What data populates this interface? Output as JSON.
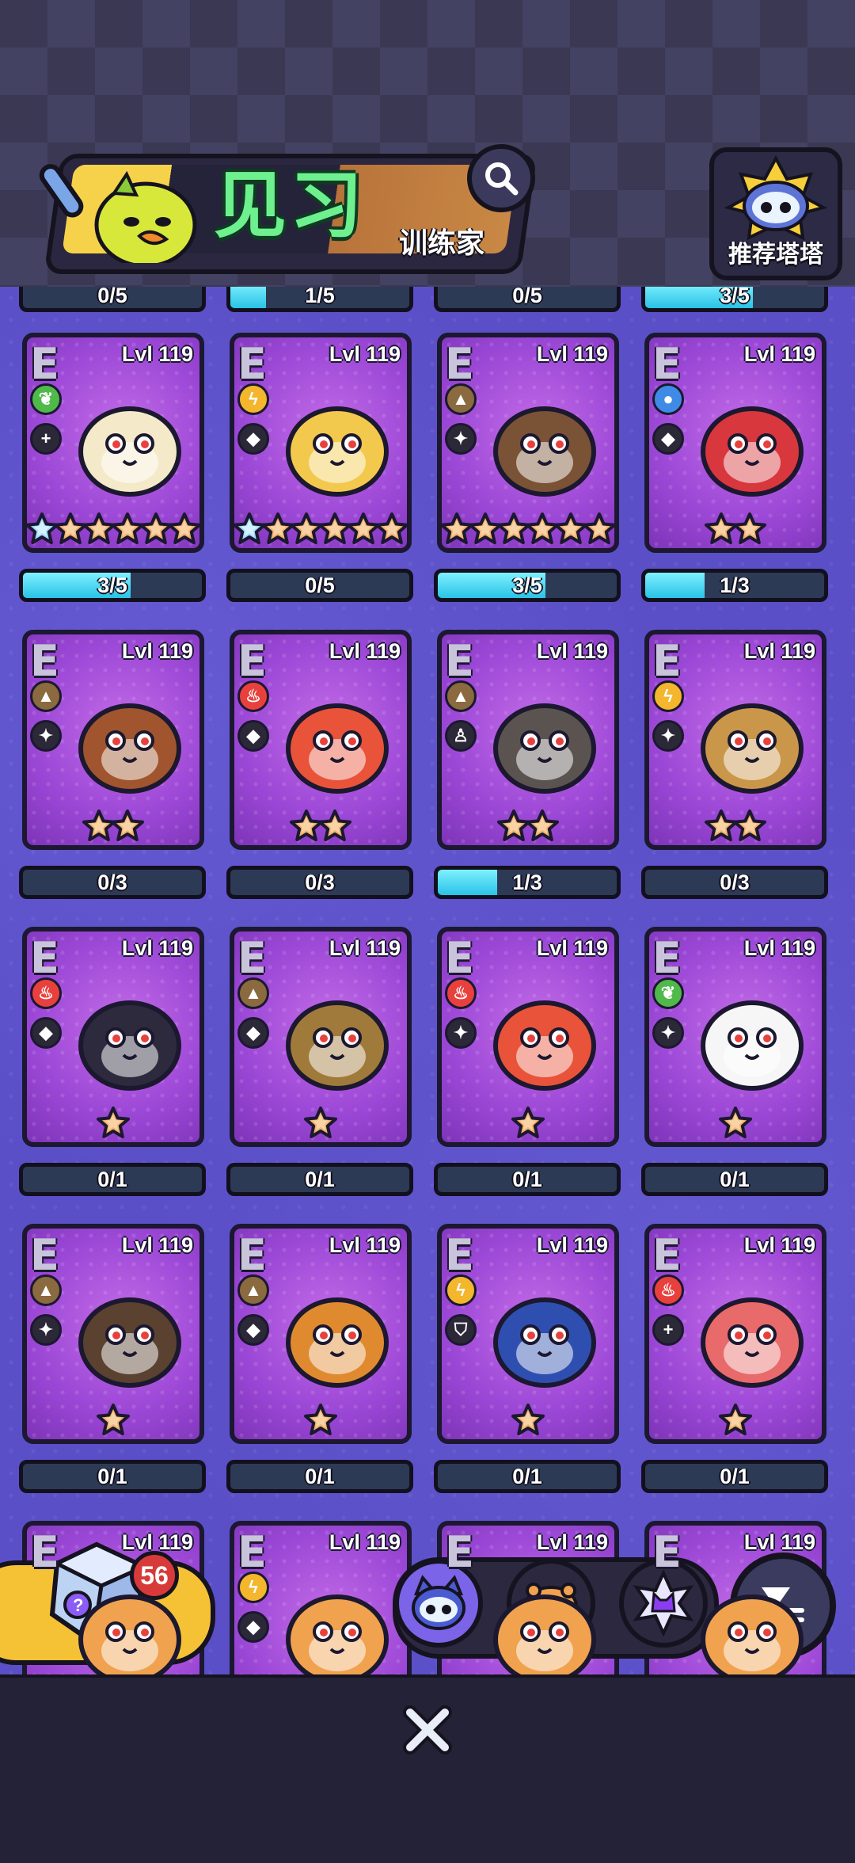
{
  "header": {
    "title": "见习",
    "subtitle": "训练家",
    "search_icon": "search-icon",
    "recommend_label": "推荐塔塔"
  },
  "top_partial_progress": [
    {
      "text": "0/5",
      "fraction": 0
    },
    {
      "text": "1/5",
      "fraction": 0.2
    },
    {
      "text": "0/5",
      "fraction": 0
    },
    {
      "text": "3/5",
      "fraction": 0.6
    }
  ],
  "cards": [
    {
      "grade": "E",
      "level": "Lvl 119",
      "element": "leaf",
      "role": "heal",
      "stars": 6,
      "blue_stars": 1,
      "progress": "3/5",
      "fraction": 0.6,
      "creature": "leaf-nest-creature"
    },
    {
      "grade": "E",
      "level": "Lvl 119",
      "element": "lightning",
      "role": "ranged",
      "stars": 6,
      "blue_stars": 1,
      "progress": "0/5",
      "fraction": 0,
      "creature": "yellow-cat-creature"
    },
    {
      "grade": "E",
      "level": "Lvl 119",
      "element": "earth",
      "role": "melee",
      "stars": 6,
      "blue_stars": 0,
      "progress": "3/5",
      "fraction": 0.6,
      "creature": "boar-creature"
    },
    {
      "grade": "E",
      "level": "Lvl 119",
      "element": "water",
      "role": "ranged",
      "stars": 2,
      "blue_stars": 0,
      "progress": "1/3",
      "fraction": 0.33,
      "creature": "crab-creature"
    },
    {
      "grade": "E",
      "level": "Lvl 119",
      "element": "earth",
      "role": "melee",
      "stars": 2,
      "blue_stars": 0,
      "progress": "0/3",
      "fraction": 0,
      "creature": "bird-creature"
    },
    {
      "grade": "E",
      "level": "Lvl 119",
      "element": "fire",
      "role": "ranged",
      "stars": 2,
      "blue_stars": 0,
      "progress": "0/3",
      "fraction": 0,
      "creature": "fire-bird-creature"
    },
    {
      "grade": "E",
      "level": "Lvl 119",
      "element": "earth",
      "role": "potion",
      "stars": 2,
      "blue_stars": 0,
      "progress": "1/3",
      "fraction": 0.33,
      "creature": "raccoon-creature"
    },
    {
      "grade": "E",
      "level": "Lvl 119",
      "element": "lightning",
      "role": "melee",
      "stars": 2,
      "blue_stars": 0,
      "progress": "0/3",
      "fraction": 0,
      "creature": "monkey-cage-creature"
    },
    {
      "grade": "E",
      "level": "Lvl 119",
      "element": "fire",
      "role": "ranged",
      "stars": 1,
      "blue_stars": 0,
      "progress": "0/1",
      "fraction": 0,
      "creature": "shiba-creature"
    },
    {
      "grade": "E",
      "level": "Lvl 119",
      "element": "earth",
      "role": "ranged",
      "stars": 1,
      "blue_stars": 0,
      "progress": "0/1",
      "fraction": 0,
      "creature": "turtle-creature"
    },
    {
      "grade": "E",
      "level": "Lvl 119",
      "element": "fire",
      "role": "melee",
      "stars": 1,
      "blue_stars": 0,
      "progress": "0/1",
      "fraction": 0,
      "creature": "red-fox-creature"
    },
    {
      "grade": "E",
      "level": "Lvl 119",
      "element": "leaf",
      "role": "melee",
      "stars": 1,
      "blue_stars": 0,
      "progress": "0/1",
      "fraction": 0,
      "creature": "panda-creature"
    },
    {
      "grade": "E",
      "level": "Lvl 119",
      "element": "earth",
      "role": "melee",
      "stars": 1,
      "blue_stars": 0,
      "progress": "0/1",
      "fraction": 0,
      "creature": "mole-creature"
    },
    {
      "grade": "E",
      "level": "Lvl 119",
      "element": "earth",
      "role": "ranged",
      "stars": 1,
      "blue_stars": 0,
      "progress": "0/1",
      "fraction": 0,
      "creature": "kangaroo-creature"
    },
    {
      "grade": "E",
      "level": "Lvl 119",
      "element": "lightning",
      "role": "shield",
      "stars": 1,
      "blue_stars": 0,
      "progress": "0/1",
      "fraction": 0,
      "creature": "toucan-creature"
    },
    {
      "grade": "E",
      "level": "Lvl 119",
      "element": "fire",
      "role": "heal",
      "stars": 1,
      "blue_stars": 0,
      "progress": "0/1",
      "fraction": 0,
      "creature": "pig-pot-creature"
    },
    {
      "grade": "E",
      "level": "Lvl 119",
      "element": "",
      "role": "",
      "stars": 0,
      "blue_stars": 0,
      "progress": "",
      "fraction": 0,
      "creature": "hidden-creature"
    },
    {
      "grade": "E",
      "level": "Lvl 119",
      "element": "lightning",
      "role": "ranged",
      "stars": 0,
      "blue_stars": 0,
      "progress": "",
      "fraction": 0,
      "creature": "red-panda-creature"
    },
    {
      "grade": "E",
      "level": "Lvl 119",
      "element": "",
      "role": "",
      "stars": 0,
      "blue_stars": 0,
      "progress": "",
      "fraction": 0,
      "creature": "hidden-creature"
    },
    {
      "grade": "E",
      "level": "Lvl 119",
      "element": "",
      "role": "",
      "stars": 0,
      "blue_stars": 0,
      "progress": "",
      "fraction": 0,
      "creature": "hidden-creature"
    }
  ],
  "bottom": {
    "chest_count": "56",
    "chest_icon": "mystery-box-icon",
    "tabs": [
      "cat-robot-tab-icon",
      "hamster-tab-icon",
      "star-cat-tab-icon"
    ],
    "filter_icon": "filter-icon",
    "close_icon": "close-icon"
  },
  "colors": {
    "card_purple": "#9b47d6",
    "progress_fill": "#29c3e6",
    "grid_bg": "#5b4fc7",
    "star": "#f2b26b"
  }
}
